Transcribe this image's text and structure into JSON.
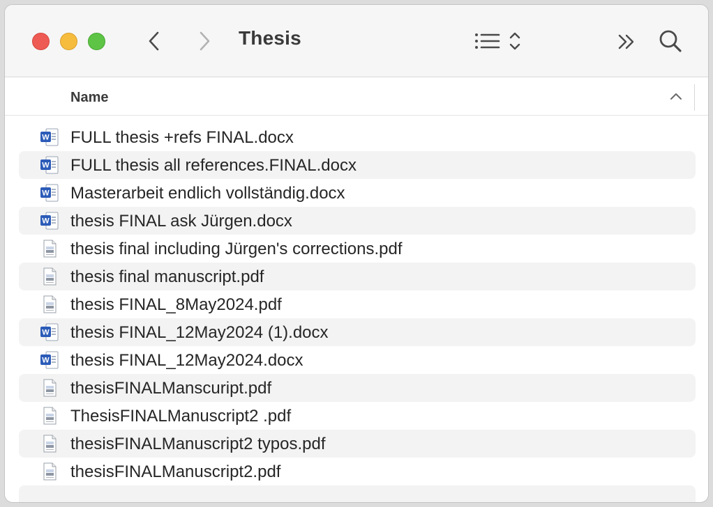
{
  "window": {
    "title": "Thesis"
  },
  "toolbar": {
    "back_icon": "chevron-left-icon",
    "forward_icon": "chevron-right-icon",
    "view_icon": "list-view-icon",
    "more_icon": "double-chevron-right-icon",
    "search_icon": "search-icon"
  },
  "header": {
    "column_name": "Name",
    "sort_icon": "chevron-up-icon"
  },
  "files": [
    {
      "name": "FULL thesis +refs FINAL.docx",
      "type": "docx"
    },
    {
      "name": "FULL thesis all references.FINAL.docx",
      "type": "docx"
    },
    {
      "name": "Masterarbeit endlich vollständig.docx",
      "type": "docx"
    },
    {
      "name": "thesis FINAL ask Jürgen.docx",
      "type": "docx"
    },
    {
      "name": "thesis final including Jürgen's corrections.pdf",
      "type": "pdf"
    },
    {
      "name": "thesis final manuscript.pdf",
      "type": "pdf"
    },
    {
      "name": "thesis FINAL_8May2024.pdf",
      "type": "pdf"
    },
    {
      "name": "thesis FINAL_12May2024 (1).docx",
      "type": "docx"
    },
    {
      "name": "thesis FINAL_12May2024.docx",
      "type": "docx"
    },
    {
      "name": "thesisFINALManscuript.pdf",
      "type": "pdf"
    },
    {
      "name": "ThesisFINALManuscript2 .pdf",
      "type": "pdf"
    },
    {
      "name": "thesisFINALManuscript2 typos.pdf",
      "type": "pdf"
    },
    {
      "name": "thesisFINALManuscript2.pdf",
      "type": "pdf"
    }
  ],
  "colors": {
    "close": "#ee5b54",
    "minimize": "#f6bc3e",
    "zoom": "#5ec446",
    "word_blue": "#2b5bb8",
    "row_alt": "#f3f3f3"
  }
}
